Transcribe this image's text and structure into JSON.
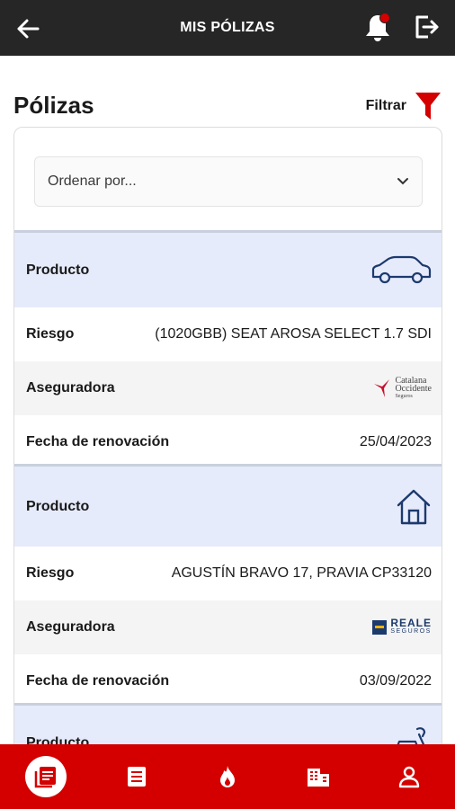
{
  "header": {
    "title": "MIS PÓLIZAS",
    "back_icon": "back-arrow-icon",
    "notification_icon": "bell-icon",
    "logout_icon": "logout-icon",
    "notification_dot_color": "#d50000"
  },
  "page": {
    "heading": "Pólizas",
    "filter_label": "Filtrar",
    "filter_icon": "funnel-icon"
  },
  "sort": {
    "placeholder": "Ordenar por...",
    "icon": "chevron-down-icon"
  },
  "policies": [
    {
      "product_label": "Producto",
      "product_icon": "car-icon",
      "risk_label": "Riesgo",
      "risk_value": "(1020GBB) SEAT AROSA SELECT 1.7 SDI",
      "insurer_label": "Aseguradora",
      "insurer_logo": {
        "line1": "Catalana",
        "line2": "Occidente",
        "line3": "Seguros"
      },
      "renewal_label": "Fecha de renovación",
      "renewal_value": "25/04/2023"
    },
    {
      "product_label": "Producto",
      "product_icon": "house-icon",
      "risk_label": "Riesgo",
      "risk_value": "AGUSTÍN BRAVO 17, PRAVIA CP33120",
      "insurer_label": "Aseguradora",
      "insurer_logo": {
        "line1": "REALE",
        "line2": "SEGUROS"
      },
      "renewal_label": "Fecha de renovación",
      "renewal_value": "03/09/2022"
    },
    {
      "product_label": "Producto",
      "product_icon": "scooter-icon"
    }
  ],
  "bottom_nav": {
    "items": [
      "policies-icon",
      "list-icon",
      "flame-icon",
      "building-icon",
      "user-icon"
    ],
    "active_index": 0,
    "bar_color": "#d40000"
  },
  "colors": {
    "accent": "#d40000",
    "product_row_bg": "#e6ebfb",
    "icon_blue": "#1c3a6e"
  }
}
